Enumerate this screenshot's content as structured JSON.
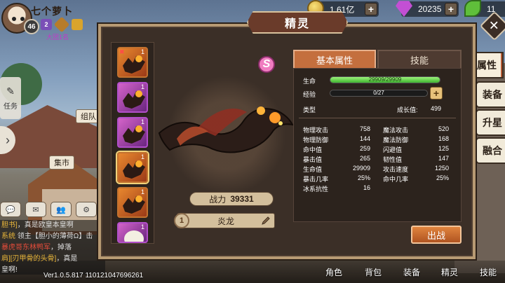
{
  "player": {
    "name": "七个萝卜",
    "level": "46",
    "vip": "2",
    "guild": "大团1名"
  },
  "currency": {
    "gold": "1.61亿",
    "gem": "20235",
    "leaf": "11"
  },
  "side": {
    "task": "任务",
    "team_tag": "组队",
    "market_tag": "集市"
  },
  "chat": {
    "lines": [
      {
        "a": "胆书]",
        "b": "，真是欧皇本皇啊"
      },
      {
        "a": "领主【胆小的薄荷Ω】击",
        "b": ""
      },
      {
        "a": "暴虎哥东林鸭军",
        "b": "，掉落"
      },
      {
        "a": "肩][刃甲骨的头骨]",
        "b": "，真是"
      },
      {
        "a": "皇啊!",
        "b": ""
      }
    ],
    "sys_label": "系统"
  },
  "version": "Ver1.0.5.817 110121047696261",
  "panel": {
    "title": "精灵",
    "close": "✕"
  },
  "pets": [
    {
      "type": "orange",
      "count": "1",
      "locked": true
    },
    {
      "type": "purple",
      "count": "1",
      "locked": false
    },
    {
      "type": "purple",
      "count": "1",
      "locked": false
    },
    {
      "type": "orange",
      "count": "1",
      "locked": false,
      "selected": true
    },
    {
      "type": "orange",
      "count": "1",
      "locked": false
    },
    {
      "type": "purple-cow",
      "count": "1",
      "locked": false
    }
  ],
  "pet_detail": {
    "rank_badge": "S",
    "power_label": "战力",
    "power": "39331",
    "name_level": "1",
    "name": "炎龙"
  },
  "tabs": {
    "base": "基本属性",
    "skill": "技能"
  },
  "attr": {
    "hp_label": "生命",
    "hp_text": "29909/29909",
    "hp_ratio": 1.0,
    "exp_label": "经验",
    "exp_text": "0/27",
    "exp_ratio": 0.0,
    "type_label": "类型",
    "grow_label": "成长值:",
    "grow_value": "499"
  },
  "stats_left": [
    {
      "label": "物理攻击",
      "value": "758"
    },
    {
      "label": "物理防御",
      "value": "144"
    },
    {
      "label": "命中值",
      "value": "259"
    },
    {
      "label": "暴击值",
      "value": "265"
    },
    {
      "label": "生命值",
      "value": "29909"
    },
    {
      "label": "暴击几率",
      "value": "25%"
    },
    {
      "label": "冰系抗性",
      "value": "16"
    }
  ],
  "stats_right": [
    {
      "label": "魔法攻击",
      "value": "520"
    },
    {
      "label": "魔法防御",
      "value": "168"
    },
    {
      "label": "闪避值",
      "value": "125"
    },
    {
      "label": "韧性值",
      "value": "147"
    },
    {
      "label": "攻击速度",
      "value": "1250"
    },
    {
      "label": "命中几率",
      "value": "25%"
    }
  ],
  "confirm_button": "出战",
  "right_tabs": [
    "属性",
    "装备",
    "升星",
    "融合"
  ],
  "bottom_nav": [
    "角色",
    "背包",
    "装备",
    "精灵",
    "技能"
  ]
}
